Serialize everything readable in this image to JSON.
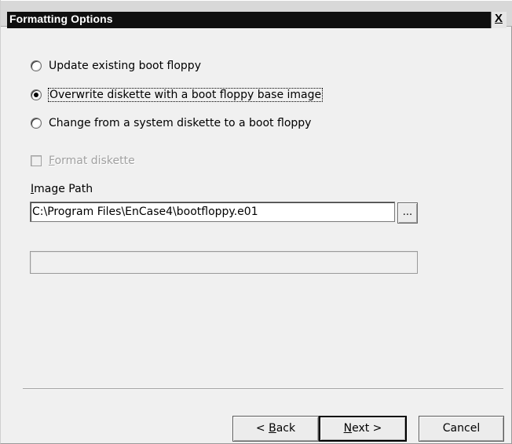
{
  "window": {
    "title": "Formatting Options",
    "close_glyph": "X"
  },
  "options": {
    "items": [
      {
        "label": "Update existing boot floppy",
        "checked": false
      },
      {
        "label": "Overwrite diskette with a boot floppy base image",
        "checked": true
      },
      {
        "label": "Change from a system diskette to a boot floppy",
        "checked": false
      }
    ]
  },
  "format_diskette": {
    "mnemonic": "F",
    "rest": "ormat diskette",
    "checked": false,
    "enabled": false
  },
  "image_path": {
    "label_mnemonic": "I",
    "label_rest": "mage Path",
    "value": "C:\\Program Files\\EnCase4\\bootfloppy.e01",
    "browse_label": "..."
  },
  "progress": {
    "percent": 0
  },
  "buttons": {
    "back_prefix": "< ",
    "back_mnemonic": "B",
    "back_rest": "ack",
    "next_mnemonic": "N",
    "next_rest": "ext >",
    "cancel": "Cancel"
  }
}
